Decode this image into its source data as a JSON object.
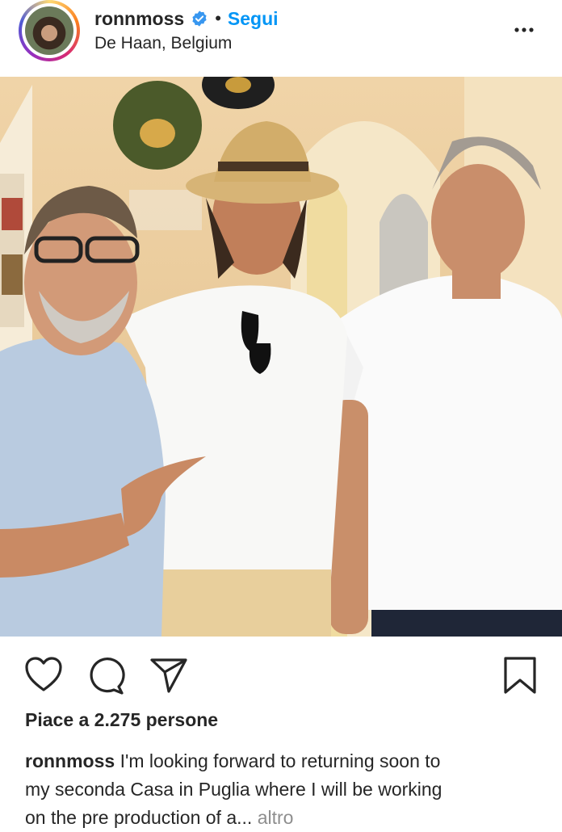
{
  "header": {
    "username": "ronnmoss",
    "separator": "•",
    "follow_label": "Segui",
    "location": "De Haan, Belgium",
    "icons": {
      "verified": "verified-badge-icon",
      "more": "more-options-icon"
    },
    "colors": {
      "follow": "#0095f6",
      "verified": "#3897f0"
    }
  },
  "post": {
    "photo_description_icon": "post-photo",
    "actions": {
      "like_icon": "heart-icon",
      "comment_icon": "comment-icon",
      "share_icon": "send-icon",
      "save_icon": "bookmark-icon"
    },
    "likes_text": "Piace a 2.275 persone",
    "caption": {
      "user": "ronnmoss",
      "line1": " I'm looking forward to returning soon to",
      "line2": "my seconda Casa in Puglia where I will be working",
      "line3": "on the pre production of a...",
      "more": " altro"
    }
  }
}
